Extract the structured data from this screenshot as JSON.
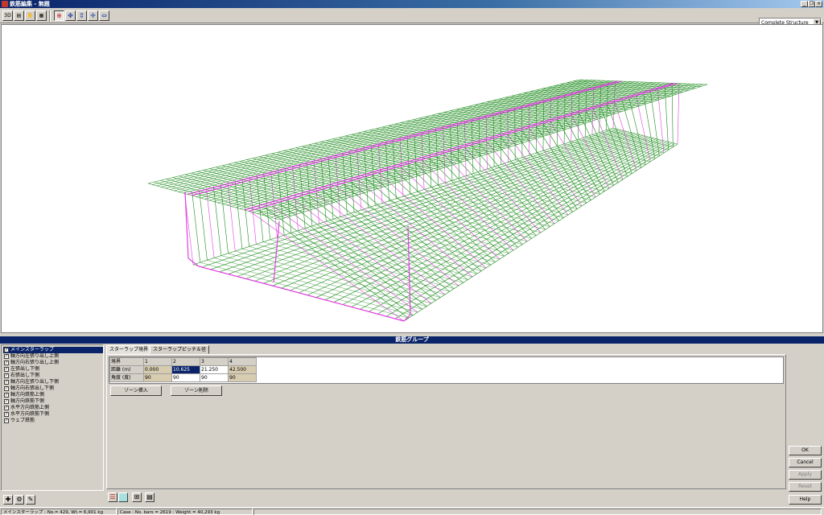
{
  "window": {
    "title": "鉄筋編集 - 無題"
  },
  "toolbar": {
    "view_3d_label": "3D",
    "structure_select_value": "Complete Structure"
  },
  "group_panel": {
    "title": "鉄筋グループ"
  },
  "rebar_list": [
    {
      "label": "メインスターラップ",
      "checked": true,
      "selected": true
    },
    {
      "label": "軸方向左張り出し上側",
      "checked": true
    },
    {
      "label": "軸方向右張り出し上側",
      "checked": true
    },
    {
      "label": "左張出し下側",
      "checked": true
    },
    {
      "label": "右張出し下側",
      "checked": true
    },
    {
      "label": "軸方向左張り出し下側",
      "checked": true
    },
    {
      "label": "軸方向右張出し下側",
      "checked": true
    },
    {
      "label": "軸方向鉄筋上側",
      "checked": true
    },
    {
      "label": "軸方向鉄筋下側",
      "checked": true
    },
    {
      "label": "水平方向鉄筋上側",
      "checked": true
    },
    {
      "label": "水平方向鉄筋下側",
      "checked": true
    },
    {
      "label": "ウェブ鉄筋",
      "checked": true
    }
  ],
  "tabs": [
    {
      "label": "スターラップ境界",
      "active": true
    },
    {
      "label": "スターラップピッチ＆径",
      "active": false
    }
  ],
  "grid": {
    "header": [
      "境界",
      "1",
      "2",
      "3",
      "4"
    ],
    "rows": [
      {
        "label": "距離 (m)",
        "cells": [
          "0.000",
          "10.625",
          "21.250",
          "42.500"
        ]
      },
      {
        "label": "角度 (度)",
        "cells": [
          "90",
          "90",
          "90",
          "90"
        ]
      }
    ]
  },
  "buttons": {
    "zone_insert": "ゾーン挿入",
    "zone_delete": "ゾーン削除",
    "ok": "OK",
    "cancel": "Cancel",
    "apply": "Apply",
    "reset": "Reset",
    "help": "Help"
  },
  "status": {
    "left": "メインスターラップ : No.= 429, Wt.=  6,901 kg",
    "right": "Case : No. bars = 2619 : Weight =  40,293 kg"
  },
  "colors": {
    "rebar_green": "#1e8c1e",
    "rebar_magenta": "#e040e0",
    "selection": "#0a246a"
  }
}
